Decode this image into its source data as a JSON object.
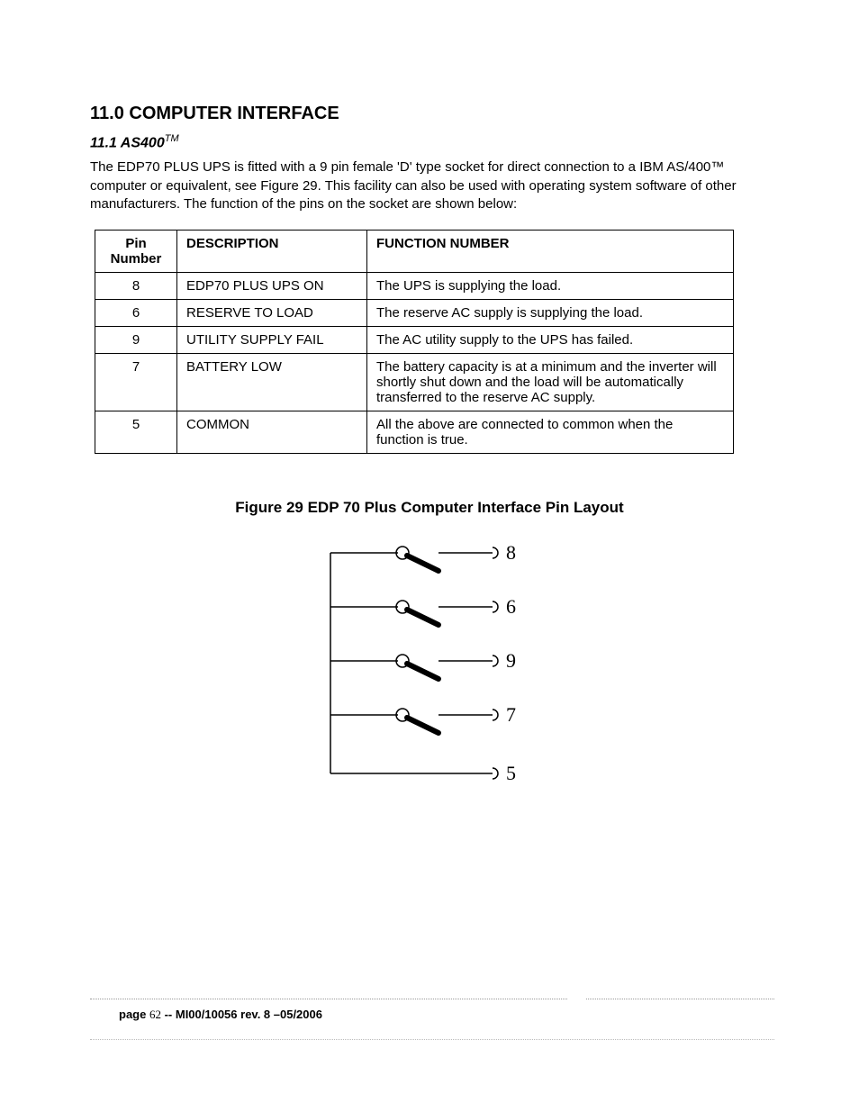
{
  "heading": "11.0   COMPUTER INTERFACE",
  "subheading": "11.1    AS400",
  "trademark": "TM",
  "intro": "The  EDP70 PLUS UPS is fitted with a 9 pin female 'D' type socket for direct connection to a IBM AS/400™ computer or equivalent, see Figure 29. This facility can also be used with operating system software of other manufacturers. The function of the pins on the socket are shown below:",
  "table": {
    "headers": [
      "Pin Number",
      "DESCRIPTION",
      "FUNCTION NUMBER"
    ],
    "rows": [
      {
        "pin": "8",
        "desc": "EDP70 PLUS UPS ON",
        "func": "The UPS is supplying the load."
      },
      {
        "pin": "6",
        "desc": "RESERVE TO LOAD",
        "func": "The  reserve AC supply is supplying the load."
      },
      {
        "pin": "9",
        "desc": "UTILITY SUPPLY FAIL",
        "func": "The  AC utility supply  to  the  UPS   has failed."
      },
      {
        "pin": "7",
        "desc": "BATTERY LOW",
        "func": "The battery capacity is at a minimum and the inverter will shortly shut down and the load will be automatically transferred to the reserve AC supply."
      },
      {
        "pin": "5",
        "desc": "COMMON",
        "func": "All the above are connected to common when the function is true."
      }
    ]
  },
  "figure_caption": "Figure 29 EDP 70 Plus Computer Interface Pin Layout",
  "pins": [
    "8",
    "6",
    "9",
    "7",
    "5"
  ],
  "footer": {
    "page_label": "page",
    "page_num": "62",
    "sep": " -- ",
    "rev": "MI00/10056 rev. 8 –05/2006"
  }
}
